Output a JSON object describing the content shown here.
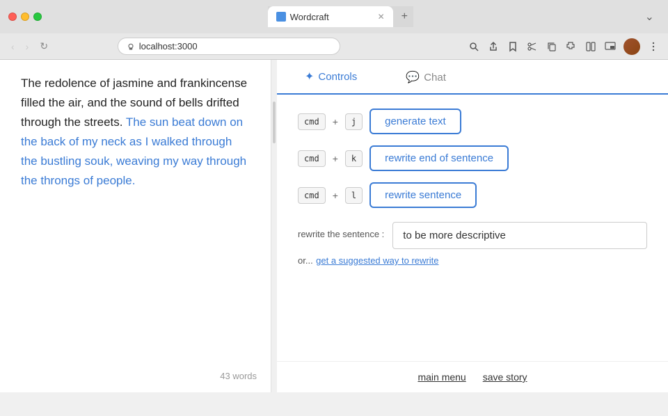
{
  "browser": {
    "tab_title": "Wordcraft",
    "url": "localhost:3000",
    "new_tab_label": "+",
    "expand_label": "⌄"
  },
  "traffic_lights": {
    "red": "red",
    "yellow": "yellow",
    "green": "green"
  },
  "editor": {
    "text_before_selection": "The redolence of jasmine and frankincense filled the air, and the sound of bells drifted through the streets. ",
    "text_selected": "The sun beat down on the back of my neck as I walked through the bustling souk, weaving my way through the throngs of people.",
    "word_count": "43 words"
  },
  "controls": {
    "tab_label": "Controls",
    "chat_tab_label": "Chat",
    "shortcut1": {
      "modifier": "cmd",
      "plus": "+",
      "key": "j",
      "action": "generate text"
    },
    "shortcut2": {
      "modifier": "cmd",
      "plus": "+",
      "key": "k",
      "action": "rewrite end of sentence"
    },
    "shortcut3": {
      "modifier": "cmd",
      "plus": "+",
      "key": "l",
      "action": "rewrite sentence"
    },
    "rewrite_label": "rewrite the sentence :",
    "rewrite_placeholder": "to be more descriptive",
    "rewrite_or_text": "or...",
    "rewrite_link_text": "get a suggested way to rewrite"
  },
  "footer": {
    "main_menu_label": "main menu",
    "save_story_label": "save story"
  }
}
